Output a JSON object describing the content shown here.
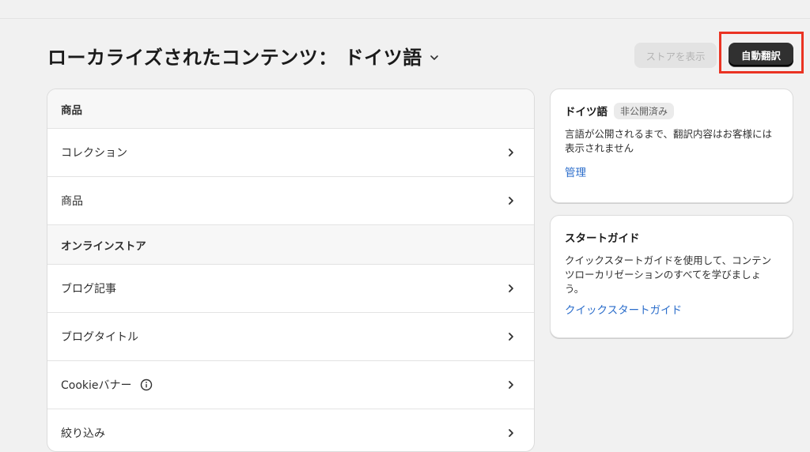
{
  "header": {
    "title": "ローカライズされたコンテンツ： ドイツ語",
    "view_store_label": "ストアを表示",
    "auto_translate_label": "自動翻訳"
  },
  "list": {
    "sections": [
      {
        "heading": "商品",
        "items": [
          {
            "label": "コレクション"
          },
          {
            "label": "商品"
          }
        ]
      },
      {
        "heading": "オンラインストア",
        "items": [
          {
            "label": "ブログ記事"
          },
          {
            "label": "ブログタイトル"
          },
          {
            "label": "Cookieバナー"
          },
          {
            "label": "絞り込み"
          }
        ]
      }
    ]
  },
  "language_card": {
    "title": "ドイツ語",
    "status_badge": "非公開済み",
    "description": "言語が公開されるまで、翻訳内容はお客様には表示されません",
    "link": "管理"
  },
  "guide_card": {
    "title": "スタートガイド",
    "description": "クイックスタートガイドを使用して、コンテンツローカリゼーションのすべてを学びましょう。",
    "link": "クイックスタートガイド"
  },
  "icons": {
    "title_dropdown": "chevron-down-icon",
    "row_arrow": "chevron-right-icon",
    "cookie_info": "info-icon"
  },
  "colors": {
    "highlight": "#ea3323",
    "primary_button": "#303030",
    "link": "#2c6ecb",
    "badge_bg": "#ebebeb"
  }
}
